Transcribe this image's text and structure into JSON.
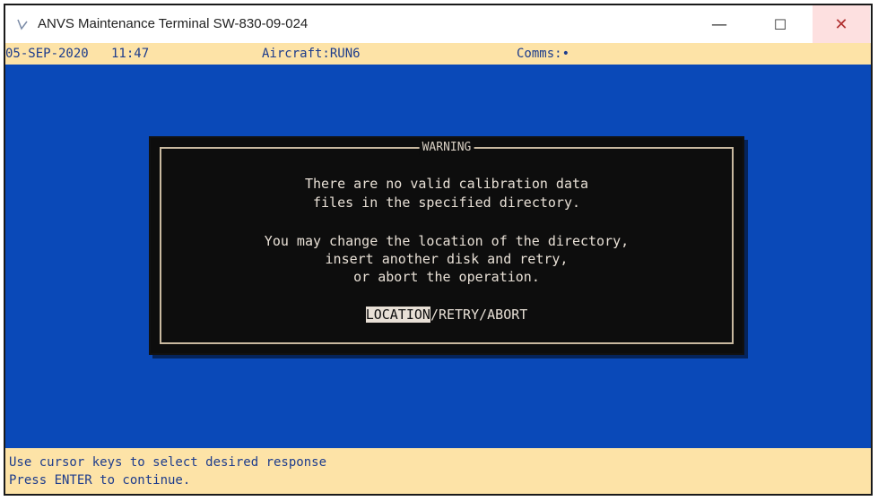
{
  "window": {
    "title": "ANVS Maintenance Terminal SW-830-09-024",
    "minimize_glyph": "—",
    "maximize_glyph": "☐",
    "close_glyph": "✕"
  },
  "status": {
    "date": "05-SEP-2020",
    "time": "11:47",
    "aircraft": "Aircraft:RUN6",
    "comms": "Comms:•"
  },
  "dialog": {
    "title": "WARNING",
    "lines": [
      "There are no valid calibration data",
      "files in the specified directory.",
      "You may change the location of the directory,",
      "insert another disk and retry,",
      "or abort the operation."
    ],
    "options": [
      "LOCATION",
      "RETRY",
      "ABORT"
    ],
    "separator": "/",
    "selected": "LOCATION"
  },
  "footer": {
    "line1": "Use cursor keys to select desired response",
    "line2": "Press ENTER to continue."
  },
  "colors": {
    "terminal_bg": "#0a49b8",
    "status_bg": "#fde3a7",
    "dialog_bg": "#0d0d0d",
    "status_text": "#1d3c8c"
  }
}
